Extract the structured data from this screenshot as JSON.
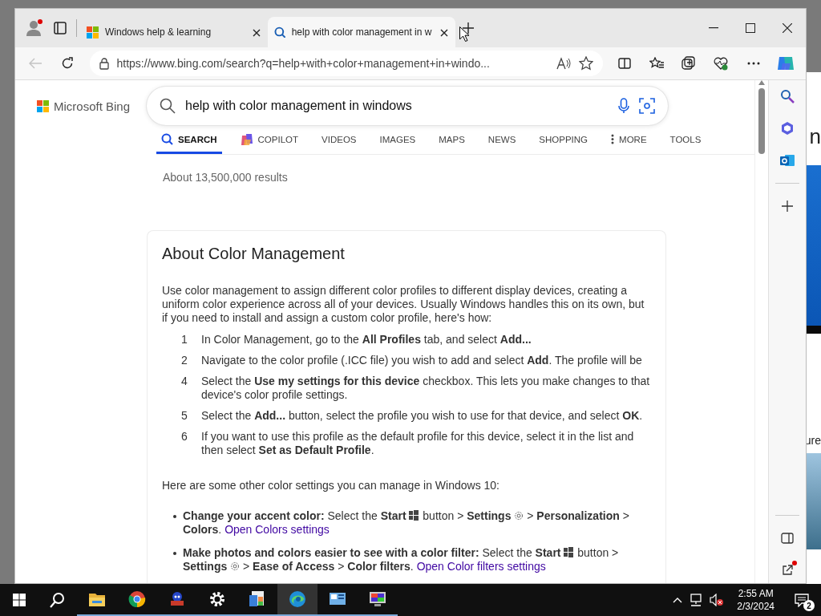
{
  "background_window": {
    "texts": [
      "n",
      "ure"
    ]
  },
  "browser": {
    "tabs": [
      {
        "title": "Windows help & learning",
        "selected": false
      },
      {
        "title": "help with color management in w",
        "selected": true
      }
    ],
    "back_button": {
      "disabled": true
    },
    "address": {
      "url": "https://www.bing.com/search?q=help+with+color+management+in+windo..."
    }
  },
  "page": {
    "logo": "Microsoft Bing",
    "query": "help with color management in windows",
    "nav_tabs": [
      {
        "label": "SEARCH",
        "selected": true
      },
      {
        "label": "COPILOT",
        "selected": false
      },
      {
        "label": "VIDEOS",
        "selected": false
      },
      {
        "label": "IMAGES",
        "selected": false
      },
      {
        "label": "MAPS",
        "selected": false
      },
      {
        "label": "NEWS",
        "selected": false
      },
      {
        "label": "SHOPPING",
        "selected": false
      },
      {
        "label": "MORE",
        "selected": false
      },
      {
        "label": "TOOLS",
        "selected": false
      }
    ],
    "result_count": "About 13,500,000 results",
    "answer": {
      "title": "About Color Management",
      "intro": "Use color management to assign different color profiles to different display devices, creating a uniform color experience across all of your devices. Usually Windows handles this on its own, but if you need to install and assign a custom color profile, here's how:",
      "steps": [
        {
          "number": "1",
          "text": "In Color Management, go to the **All Profiles** tab, and select **Add...**"
        },
        {
          "number": "2",
          "text": "Navigate to the color profile (.ICC file) you wish to add and select **Add**. The profile will be"
        },
        {
          "number": "4",
          "text": "Select the **Use my settings for this device** checkbox. This lets you make changes to that device's color profile settings."
        },
        {
          "number": "5",
          "text": "Select the **Add...** button, select the profile you wish to use for that device, and select **OK**."
        },
        {
          "number": "6",
          "text": "If you want to use this profile as the default profile for this device, select it in the list and then select **Set as Default Profile**."
        }
      ],
      "note": "Here are some other color settings you can manage in Windows 10:",
      "bullets": [
        {
          "parts": [
            {
              "kind": "text",
              "text": "**Change your accent color:** Select the **Start** "
            },
            {
              "kind": "start"
            },
            {
              "kind": "text",
              "text": " button > **Settings** "
            },
            {
              "kind": "gear"
            },
            {
              "kind": "text",
              "text": " > **Personalization** > **Colors**. "
            },
            {
              "kind": "link",
              "text": "Open Colors settings"
            }
          ]
        },
        {
          "parts": [
            {
              "kind": "text",
              "text": "**Make photos and colors easier to see with a color filter:** Select the **Start** "
            },
            {
              "kind": "start"
            },
            {
              "kind": "text",
              "text": " button > **Settings** "
            },
            {
              "kind": "gear"
            },
            {
              "kind": "text",
              "text": " > **Ease of Access** > **Color filters**. "
            },
            {
              "kind": "link",
              "text": "Open Color filters settings"
            }
          ]
        }
      ]
    }
  },
  "taskbar": {
    "apps": [
      {
        "kind": "explorer",
        "running": true,
        "active": false
      },
      {
        "kind": "chrome",
        "running": true,
        "active": false
      },
      {
        "kind": "game",
        "running": true,
        "active": false
      },
      {
        "kind": "settings",
        "running": true,
        "active": false
      },
      {
        "kind": "colorapp",
        "running": true,
        "active": false
      },
      {
        "kind": "edge",
        "running": true,
        "active": true
      },
      {
        "kind": "panel",
        "running": true,
        "active": false
      },
      {
        "kind": "monitor",
        "running": true,
        "active": false
      }
    ],
    "clock": {
      "time": "2:55 AM",
      "date": "2/3/2024"
    },
    "notifications": "2"
  }
}
